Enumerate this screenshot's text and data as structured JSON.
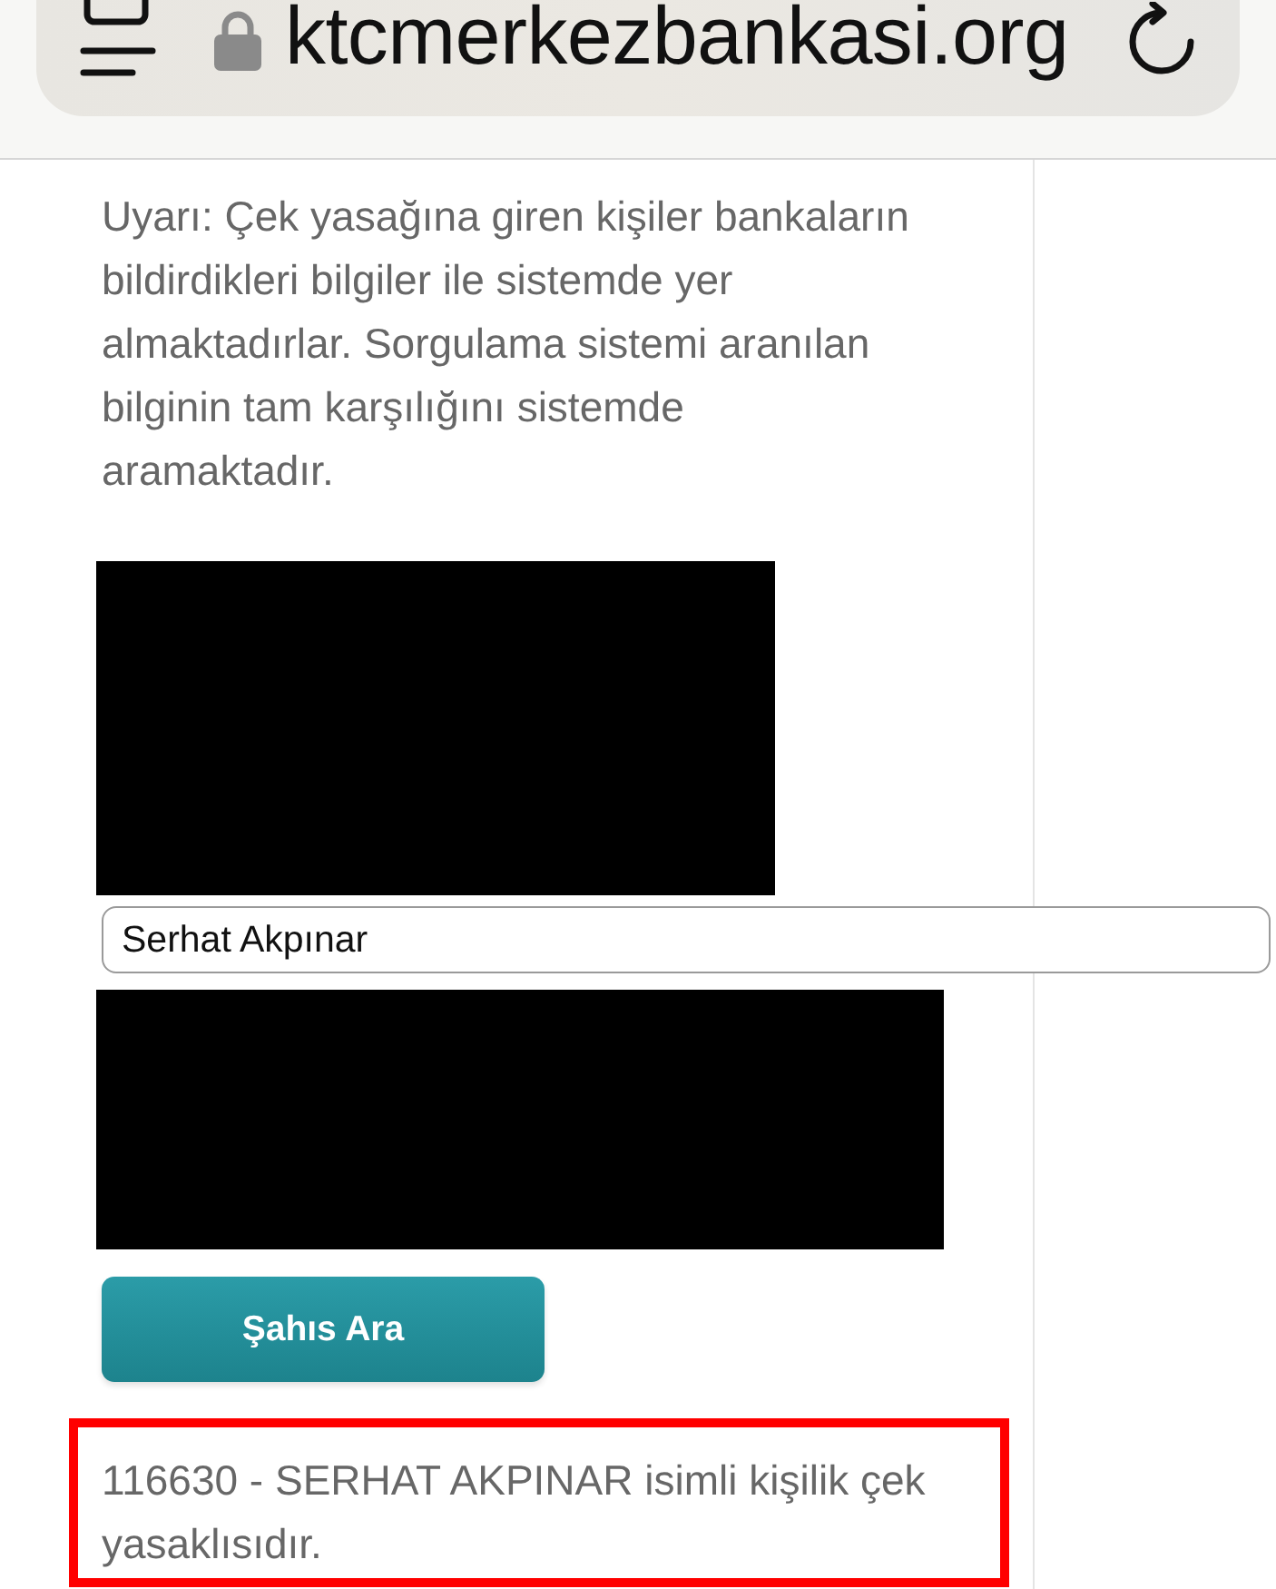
{
  "browser": {
    "url": "ktcmerkezbankasi.org"
  },
  "warning": "Uyarı: Çek yasağına giren kişiler bankaların\nbildirdikleri bilgiler ile sistemde yer\nalmaktadırlar. Sorgulama sistemi aranılan\nbilginin tam karşılığını sistemde\naramaktadır.",
  "search_field": {
    "value": "Serhat Akpınar"
  },
  "search_button": {
    "label": "Şahıs Ara"
  },
  "result": {
    "text": "116630 - SERHAT AKPINAR isimli kişilik çek yasaklısıdır.",
    "highlighted": true
  }
}
